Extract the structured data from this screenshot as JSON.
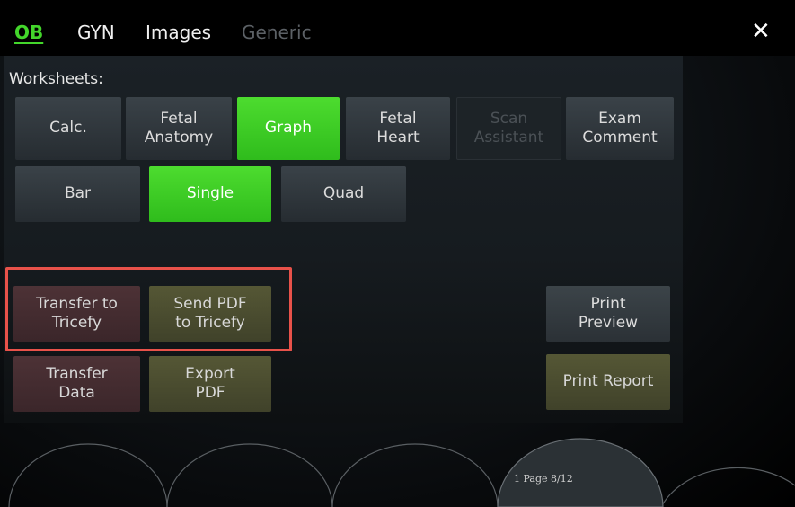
{
  "tabs": [
    {
      "label": "OB",
      "state": "active"
    },
    {
      "label": "GYN",
      "state": "normal"
    },
    {
      "label": "Images",
      "state": "normal"
    },
    {
      "label": "Generic",
      "state": "disabled"
    }
  ],
  "close_icon": "close-icon",
  "worksheets_label": "Worksheets:",
  "worksheet_buttons": {
    "calc": "Calc.",
    "fetal_anatomy": "Fetal\nAnatomy",
    "graph": "Graph",
    "fetal_heart": "Fetal\nHeart",
    "scan_assistant": "Scan\nAssistant",
    "exam_comment": "Exam\nComment"
  },
  "graph_buttons": {
    "bar": "Bar",
    "single": "Single",
    "quad": "Quad"
  },
  "actions": {
    "transfer_tricefy": "Transfer to\nTricefy",
    "send_pdf_tricefy": "Send PDF\nto Tricefy",
    "transfer_data": "Transfer\nData",
    "export_pdf": "Export\nPDF",
    "print_preview": "Print\nPreview",
    "print_report": "Print Report"
  },
  "page_indicator": "1 Page 8/12",
  "colors": {
    "accent_green": "#43d62b",
    "highlight_red": "#e8524a"
  }
}
